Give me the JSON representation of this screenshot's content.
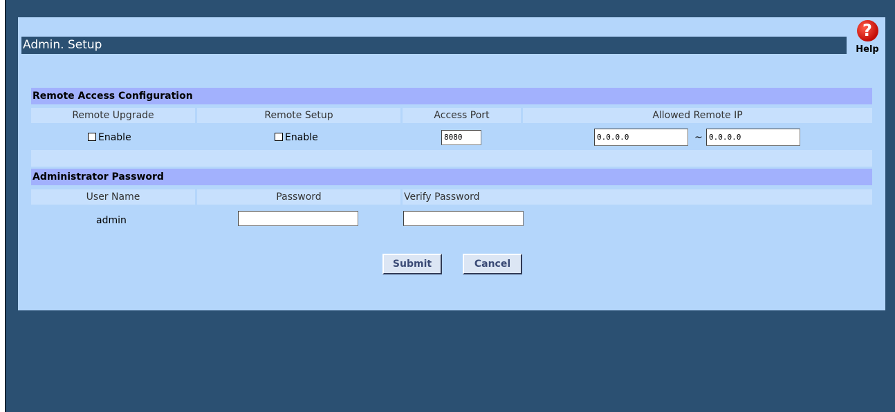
{
  "page": {
    "title": "Admin. Setup",
    "help_label": "Help",
    "help_glyph": "?"
  },
  "remote_access": {
    "section_title": "Remote Access Configuration",
    "headers": [
      "Remote Upgrade",
      "Remote Setup",
      "Access Port",
      "Allowed Remote IP"
    ],
    "remote_upgrade_label": "Enable",
    "remote_upgrade_checked": false,
    "remote_setup_label": "Enable",
    "remote_setup_checked": false,
    "access_port": "8080",
    "ip_start": "0.0.0.0",
    "ip_separator": "~",
    "ip_end": "0.0.0.0"
  },
  "admin_password": {
    "section_title": "Administrator Password",
    "headers": [
      "User Name",
      "Password",
      "Verify Password"
    ],
    "user_name": "admin",
    "password": "",
    "verify_password": ""
  },
  "buttons": {
    "submit": "Submit",
    "cancel": "Cancel"
  },
  "colors": {
    "background": "#2b5072",
    "panel": "#b4d6fb",
    "section_header": "#a2b1fd",
    "column_header": "#c7e0fd",
    "help": "#d4140e"
  }
}
